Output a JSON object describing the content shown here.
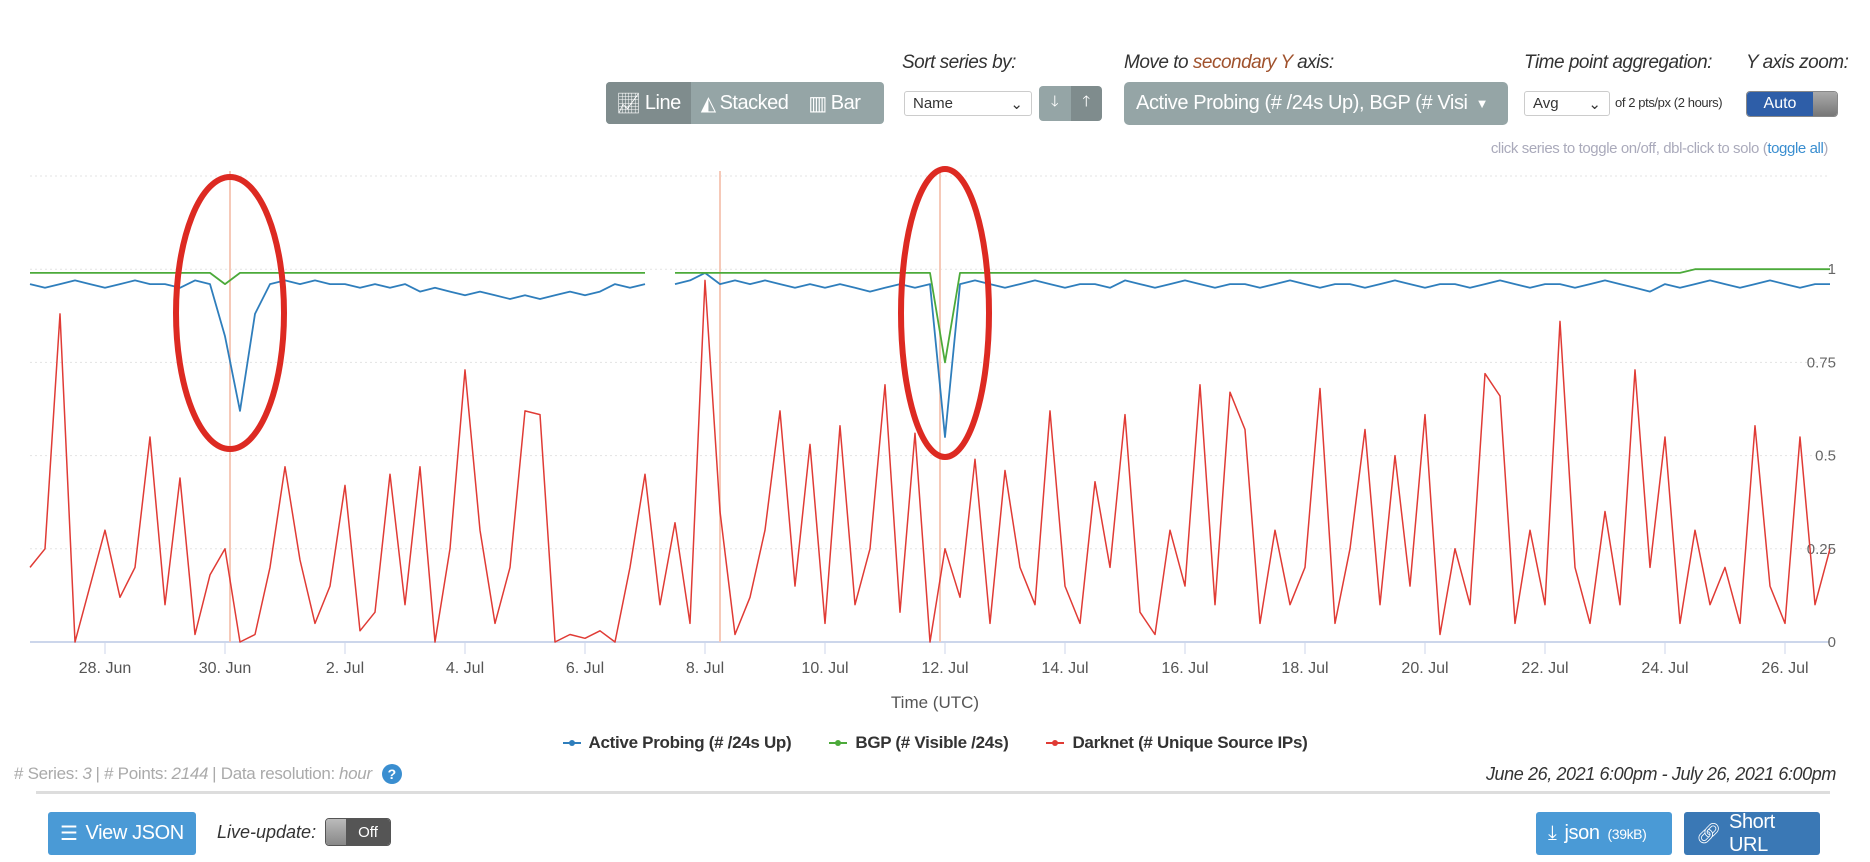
{
  "controls": {
    "chart_types": [
      {
        "label": "Line",
        "icon": "line-chart-icon",
        "active": true
      },
      {
        "label": "Stacked",
        "icon": "area-chart-icon",
        "active": false
      },
      {
        "label": "Bar",
        "icon": "bar-chart-icon",
        "active": false
      }
    ],
    "sort_label": "Sort series by:",
    "sort_value": "Name",
    "secondary_label_pre": "Move to ",
    "secondary_label_acc": "secondary Y",
    "secondary_label_post": " axis:",
    "secondary_value": "Active Probing (# /24s Up), BGP (# Visi",
    "aggregation_label": "Time point aggregation:",
    "aggregation_value": "Avg",
    "aggregation_note": "of 2 pts/px (2 hours)",
    "yzoom_label": "Y axis zoom:",
    "yzoom_value": "Auto",
    "hint": "click series to toggle on/off, dbl-click to solo (",
    "hint_link": "toggle all",
    "hint_end": ")"
  },
  "footer": {
    "series_label": "# Series:",
    "series_count": "3",
    "points_label": "| # Points:",
    "points_count": "2144",
    "resolution_label": "| Data resolution:",
    "resolution": "hour",
    "help": "?",
    "date_range": "June 26, 2021 6:00pm - July 26, 2021 6:00pm",
    "view_json": "View JSON",
    "live_label": "Live-update:",
    "live_value": "Off",
    "json_label": "json",
    "json_size": "(39kB)",
    "short_url": "Short URL"
  },
  "colors": {
    "active_probing": "#2f7ebc",
    "bgp": "#4caa3a",
    "darknet": "#e03b35",
    "annotation": "#dd2a22",
    "event_line": "#f6c9b8",
    "button": "#4a9ad6",
    "button_dark": "#3a78b5"
  },
  "chart_data": {
    "type": "line",
    "xlabel": "Time (UTC)",
    "time_range": [
      "2021-06-26T18:00Z",
      "2021-07-26T18:00Z"
    ],
    "x_ticks": [
      {
        "label": "28. Jun",
        "date": "2021-06-28"
      },
      {
        "label": "30. Jun",
        "date": "2021-06-30"
      },
      {
        "label": "2. Jul",
        "date": "2021-07-02"
      },
      {
        "label": "4. Jul",
        "date": "2021-07-04"
      },
      {
        "label": "6. Jul",
        "date": "2021-07-06"
      },
      {
        "label": "8. Jul",
        "date": "2021-07-08"
      },
      {
        "label": "10. Jul",
        "date": "2021-07-10"
      },
      {
        "label": "12. Jul",
        "date": "2021-07-12"
      },
      {
        "label": "14. Jul",
        "date": "2021-07-14"
      },
      {
        "label": "16. Jul",
        "date": "2021-07-16"
      },
      {
        "label": "18. Jul",
        "date": "2021-07-18"
      },
      {
        "label": "20. Jul",
        "date": "2021-07-20"
      },
      {
        "label": "22. Jul",
        "date": "2021-07-22"
      },
      {
        "label": "24. Jul",
        "date": "2021-07-24"
      },
      {
        "label": "26. Jul",
        "date": "2021-07-26"
      }
    ],
    "y_ticks": [
      "0",
      "0.25",
      "0.5",
      "0.75",
      "1"
    ],
    "ylim": [
      0,
      1.25
    ],
    "grid": true,
    "legend": "bottom",
    "event_markers": [
      "2021-06-30T02:00Z",
      "2021-07-08T06:00Z",
      "2021-07-11T22:00Z"
    ],
    "annotations": [
      {
        "type": "circle",
        "at": "2021-06-30T02:00Z"
      },
      {
        "type": "circle",
        "at": "2021-07-12T00:00Z"
      }
    ],
    "series": [
      {
        "name": "Active Probing (# /24s Up)",
        "key": "active_probing",
        "values": [
          0.96,
          0.95,
          0.96,
          0.97,
          0.96,
          0.95,
          0.96,
          0.97,
          0.96,
          0.96,
          0.95,
          0.97,
          0.96,
          0.82,
          0.62,
          0.88,
          0.96,
          0.97,
          0.96,
          0.97,
          0.96,
          0.96,
          0.95,
          0.96,
          0.95,
          0.96,
          0.94,
          0.95,
          0.94,
          0.93,
          0.94,
          0.93,
          0.92,
          0.93,
          0.92,
          0.93,
          0.94,
          0.93,
          0.94,
          0.96,
          0.95,
          0.96,
          null,
          0.96,
          0.97,
          0.99,
          0.96,
          0.97,
          0.96,
          0.97,
          0.96,
          0.95,
          0.96,
          0.95,
          0.96,
          0.95,
          0.94,
          0.95,
          0.96,
          0.95,
          0.96,
          0.55,
          0.96,
          0.97,
          0.96,
          0.95,
          0.96,
          0.97,
          0.96,
          0.95,
          0.96,
          0.96,
          0.95,
          0.97,
          0.96,
          0.95,
          0.96,
          0.97,
          0.96,
          0.95,
          0.96,
          0.96,
          0.95,
          0.96,
          0.97,
          0.96,
          0.95,
          0.96,
          0.96,
          0.95,
          0.96,
          0.97,
          0.96,
          0.95,
          0.96,
          0.96,
          0.95,
          0.96,
          0.97,
          0.96,
          0.95,
          0.96,
          0.96,
          0.95,
          0.96,
          0.97,
          0.96,
          0.95,
          0.94,
          0.96,
          0.95,
          0.96,
          0.97,
          0.96,
          0.95,
          0.96,
          0.97,
          0.96,
          0.95,
          0.96,
          0.96
        ]
      },
      {
        "name": "BGP (# Visible /24s)",
        "key": "bgp",
        "values": [
          0.99,
          0.99,
          0.99,
          0.99,
          0.99,
          0.99,
          0.99,
          0.99,
          0.99,
          0.99,
          0.99,
          0.99,
          0.99,
          0.96,
          0.99,
          0.99,
          0.99,
          0.99,
          0.99,
          0.99,
          0.99,
          0.99,
          0.99,
          0.99,
          0.99,
          0.99,
          0.99,
          0.99,
          0.99,
          0.99,
          0.99,
          0.99,
          0.99,
          0.99,
          0.99,
          0.99,
          0.99,
          0.99,
          0.99,
          0.99,
          0.99,
          0.99,
          null,
          0.99,
          0.99,
          0.99,
          0.99,
          0.99,
          0.99,
          0.99,
          0.99,
          0.99,
          0.99,
          0.99,
          0.99,
          0.99,
          0.99,
          0.99,
          0.99,
          0.99,
          0.99,
          0.75,
          0.99,
          0.99,
          0.99,
          0.99,
          0.99,
          0.99,
          0.99,
          0.99,
          0.99,
          0.99,
          0.99,
          0.99,
          0.99,
          0.99,
          0.99,
          0.99,
          0.99,
          0.99,
          0.99,
          0.99,
          0.99,
          0.99,
          0.99,
          0.99,
          0.99,
          0.99,
          0.99,
          0.99,
          0.99,
          0.99,
          0.99,
          0.99,
          0.99,
          0.99,
          0.99,
          0.99,
          0.99,
          0.99,
          0.99,
          0.99,
          0.99,
          0.99,
          0.99,
          0.99,
          0.99,
          0.99,
          0.99,
          0.99,
          0.99,
          1.0,
          1.0,
          1.0,
          1.0,
          1.0,
          1.0,
          1.0,
          1.0,
          1.0,
          1.0
        ]
      },
      {
        "name": "Darknet (# Unique Source IPs)",
        "key": "darknet",
        "values": [
          0.2,
          0.25,
          0.88,
          0.0,
          0.15,
          0.3,
          0.12,
          0.2,
          0.55,
          0.1,
          0.44,
          0.02,
          0.18,
          0.25,
          0.0,
          0.02,
          0.2,
          0.47,
          0.22,
          0.05,
          0.15,
          0.42,
          0.03,
          0.08,
          0.45,
          0.1,
          0.47,
          0.0,
          0.25,
          0.73,
          0.3,
          0.05,
          0.2,
          0.62,
          0.61,
          0.0,
          0.02,
          0.01,
          0.03,
          0.0,
          0.2,
          0.45,
          0.1,
          0.32,
          0.05,
          0.97,
          0.35,
          0.02,
          0.12,
          0.3,
          0.62,
          0.15,
          0.53,
          0.05,
          0.58,
          0.1,
          0.25,
          0.69,
          0.08,
          0.56,
          0.0,
          0.25,
          0.12,
          0.49,
          0.05,
          0.46,
          0.2,
          0.1,
          0.62,
          0.15,
          0.05,
          0.43,
          0.2,
          0.61,
          0.08,
          0.02,
          0.3,
          0.15,
          0.69,
          0.1,
          0.67,
          0.57,
          0.05,
          0.3,
          0.1,
          0.2,
          0.68,
          0.05,
          0.25,
          0.57,
          0.1,
          0.5,
          0.15,
          0.61,
          0.02,
          0.25,
          0.1,
          0.72,
          0.66,
          0.05,
          0.3,
          0.1,
          0.86,
          0.2,
          0.05,
          0.35,
          0.1,
          0.73,
          0.2,
          0.55,
          0.05,
          0.3,
          0.1,
          0.2,
          0.05,
          0.58,
          0.15,
          0.05,
          0.55,
          0.1,
          0.25
        ]
      }
    ]
  }
}
